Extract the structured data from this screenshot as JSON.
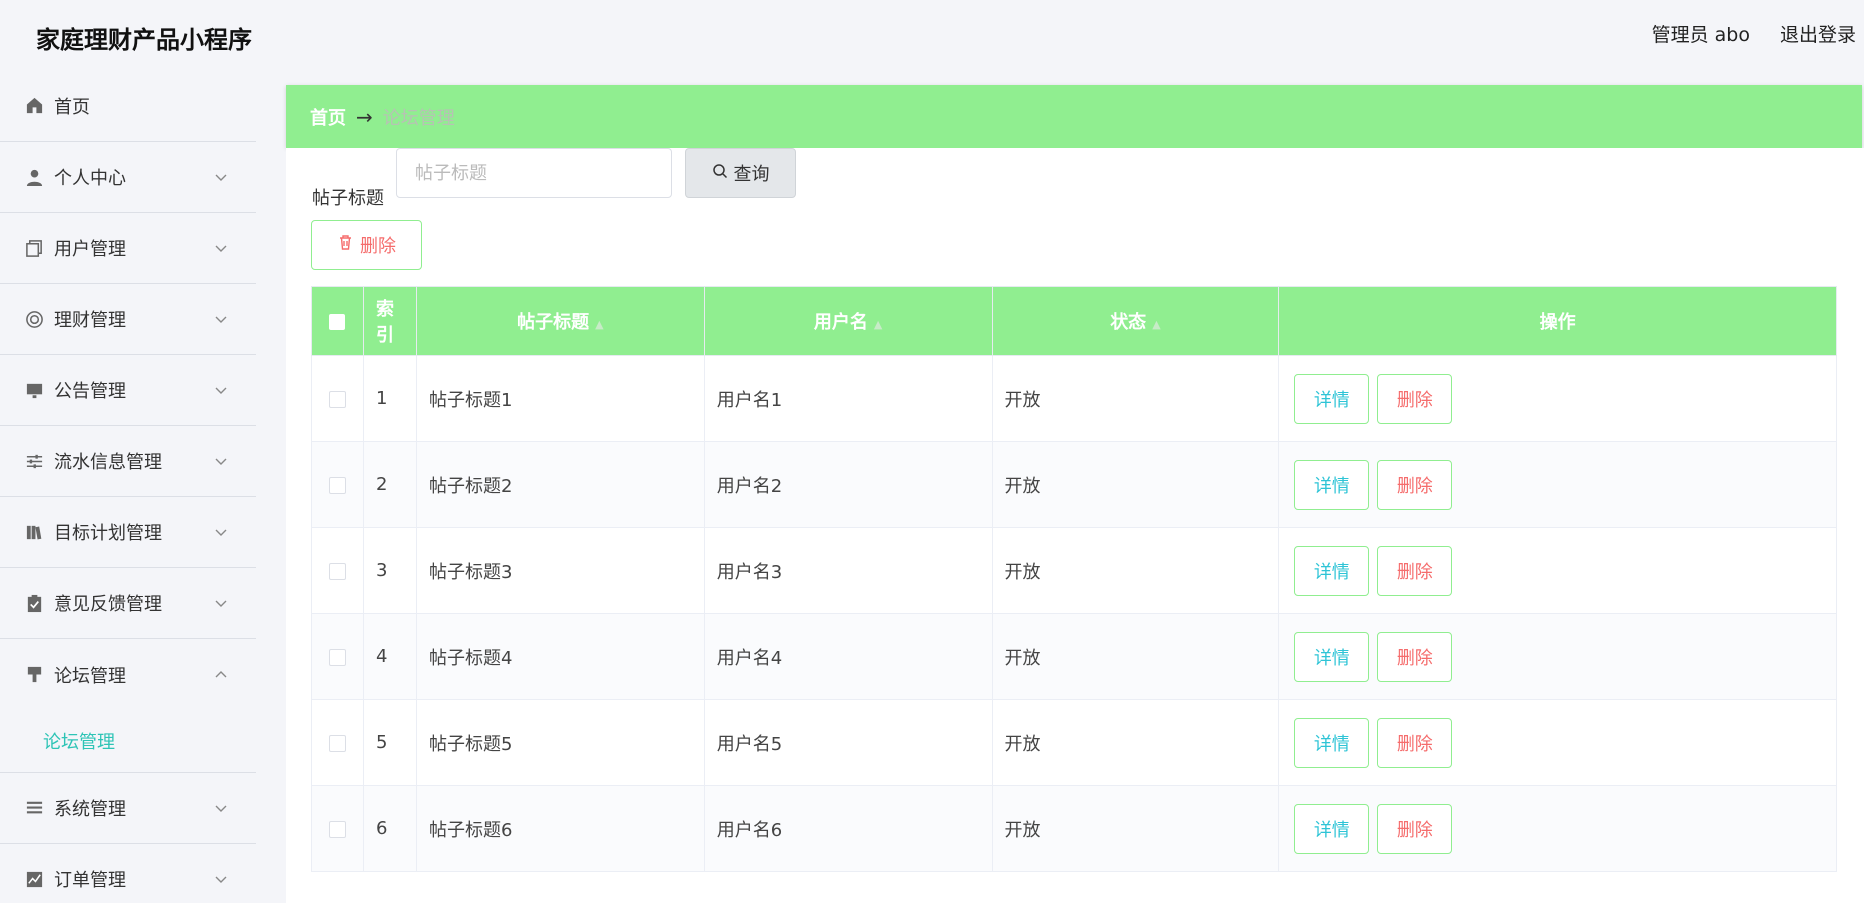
{
  "app": {
    "title": "家庭理财产品小程序"
  },
  "topbar": {
    "user_label": "管理员 abo",
    "logout_label": "退出登录"
  },
  "sidebar": {
    "items": [
      {
        "label": "首页",
        "icon": "home-icon"
      },
      {
        "label": "个人中心",
        "icon": "user-icon"
      },
      {
        "label": "用户管理",
        "icon": "copy-icon"
      },
      {
        "label": "理财管理",
        "icon": "lifebuoy-icon"
      },
      {
        "label": "公告管理",
        "icon": "monitor-icon"
      },
      {
        "label": "流水信息管理",
        "icon": "sliders-icon"
      },
      {
        "label": "目标计划管理",
        "icon": "books-icon"
      },
      {
        "label": "意见反馈管理",
        "icon": "clipboard-icon"
      },
      {
        "label": "论坛管理",
        "icon": "paintbrush-icon",
        "open": true
      },
      {
        "label": "系统管理",
        "icon": "list-icon"
      },
      {
        "label": "订单管理",
        "icon": "chart-icon"
      }
    ],
    "submenu_forum": "论坛管理"
  },
  "breadcrumb": {
    "home": "首页",
    "arrow": "→",
    "current": "论坛管理"
  },
  "search": {
    "label": "帖子标题",
    "placeholder": "帖子标题",
    "value": "",
    "button_label": "查询"
  },
  "toolbar": {
    "delete_label": "删除"
  },
  "table": {
    "headers": {
      "index": "索引",
      "title": "帖子标题",
      "username": "用户名",
      "status": "状态",
      "actions": "操作"
    },
    "rows": [
      {
        "index": "1",
        "title": "帖子标题1",
        "username": "用户名1",
        "status": "开放"
      },
      {
        "index": "2",
        "title": "帖子标题2",
        "username": "用户名2",
        "status": "开放"
      },
      {
        "index": "3",
        "title": "帖子标题3",
        "username": "用户名3",
        "status": "开放"
      },
      {
        "index": "4",
        "title": "帖子标题4",
        "username": "用户名4",
        "status": "开放"
      },
      {
        "index": "5",
        "title": "帖子标题5",
        "username": "用户名5",
        "status": "开放"
      },
      {
        "index": "6",
        "title": "帖子标题6",
        "username": "用户名6",
        "status": "开放"
      }
    ],
    "detail_label": "详情",
    "delete_label": "删除"
  },
  "colors": {
    "accent_green": "#90ee90",
    "link_teal": "#2ec4b6",
    "danger": "#f56c6c"
  }
}
